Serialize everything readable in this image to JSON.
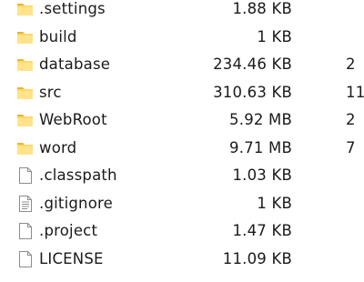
{
  "colors": {
    "folder_body": "#ffd967",
    "folder_tab": "#e8b33a",
    "folder_front": "#ffe38b",
    "file_body": "#ffffff",
    "file_border": "#8c8c8c",
    "text": "#1a1a1a"
  },
  "files": [
    {
      "name": ".settings",
      "size": "1.88 KB",
      "extra": "",
      "icon": "folder-icon"
    },
    {
      "name": "build",
      "size": "1 KB",
      "extra": "",
      "icon": "folder-icon"
    },
    {
      "name": "database",
      "size": "234.46 KB",
      "extra": "2",
      "icon": "folder-icon"
    },
    {
      "name": "src",
      "size": "310.63 KB",
      "extra": "11",
      "icon": "folder-icon"
    },
    {
      "name": "WebRoot",
      "size": "5.92 MB",
      "extra": "2",
      "icon": "folder-icon"
    },
    {
      "name": "word",
      "size": "9.71 MB",
      "extra": "7",
      "icon": "folder-icon"
    },
    {
      "name": ".classpath",
      "size": "1.03 KB",
      "extra": "",
      "icon": "file-icon"
    },
    {
      "name": ".gitignore",
      "size": "1 KB",
      "extra": "",
      "icon": "text-file-icon"
    },
    {
      "name": ".project",
      "size": "1.47 KB",
      "extra": "",
      "icon": "file-icon"
    },
    {
      "name": "LICENSE",
      "size": "11.09 KB",
      "extra": "",
      "icon": "file-icon"
    }
  ]
}
